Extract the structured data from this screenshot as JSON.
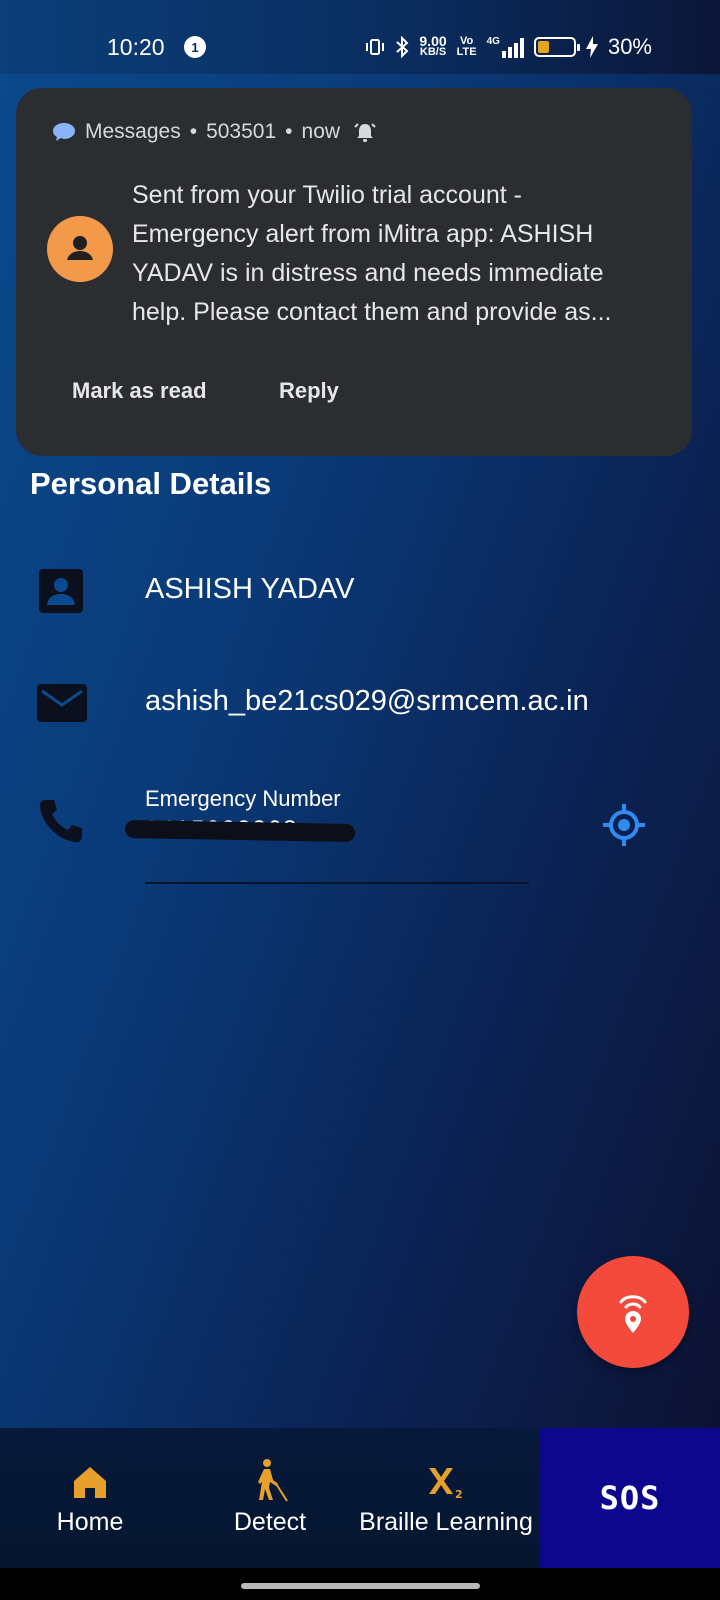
{
  "status_bar": {
    "time": "10:20",
    "notification_count": "1",
    "net_speed_top": "9.00",
    "net_speed_bottom": "KB/S",
    "volte_top": "Vo",
    "volte_bottom": "LTE",
    "network": "4G",
    "battery_percent": "30%",
    "battery_level": 0.3,
    "icons": [
      "vibrate-icon",
      "bluetooth-icon",
      "signal-icon",
      "battery-icon",
      "charging-icon"
    ]
  },
  "notification": {
    "app_name": "Messages",
    "sender": "503501",
    "time": "now",
    "separator": "•",
    "message_lines": [
      "Sent from your Twilio trial account -",
      "Emergency alert from iMitra app: ASHISH",
      "YADAV is in distress and needs immediate",
      "help. Please contact them and provide as..."
    ],
    "actions": {
      "mark_read": "Mark as read",
      "reply": "Reply"
    },
    "avatar_color": "#f39a4a"
  },
  "personal": {
    "title": "Personal Details",
    "name": "ASHISH YADAV",
    "email": "ashish_be21cs029@srmcem.ac.in",
    "emergency_label": "Emergency Number",
    "emergency_value": "9415000268"
  },
  "nav": {
    "home": "Home",
    "detect": "Detect",
    "braille": "Braille Learning",
    "sos": "SOS"
  },
  "colors": {
    "accent_orange": "#e8a02c",
    "fab_red": "#f44a3c",
    "sos_bg": "#0d078e",
    "locate_blue": "#2f8bf0"
  }
}
